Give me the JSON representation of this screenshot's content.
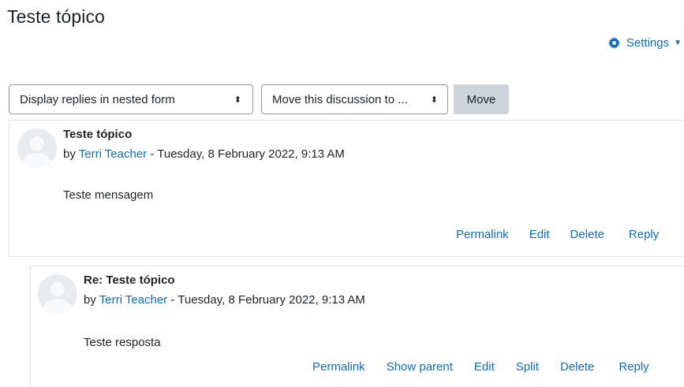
{
  "page": {
    "title": "Teste tópico"
  },
  "settings": {
    "label": "Settings",
    "icon": "gear-icon"
  },
  "controls": {
    "display_mode": "Display replies in nested form",
    "move_target": "Move this discussion to ...",
    "move_button": "Move"
  },
  "posts": [
    {
      "subject": "Teste tópico",
      "by": "by",
      "author": "Terri Teacher",
      "date": "- Tuesday, 8 February 2022, 9:13 AM",
      "message": "Teste mensagem",
      "actions": [
        "Permalink",
        "Edit",
        "Delete",
        "Reply"
      ]
    },
    {
      "subject": "Re: Teste tópico",
      "by": "by",
      "author": "Terri Teacher",
      "date": "- Tuesday, 8 February 2022, 9:13 AM",
      "message": "Teste resposta",
      "actions": [
        "Permalink",
        "Show parent",
        "Edit",
        "Split",
        "Delete",
        "Reply"
      ]
    }
  ],
  "colors": {
    "link": "#0f6cbf",
    "text": "#1d2125",
    "button_bg": "#ced4da",
    "border": "#dee2e6"
  }
}
